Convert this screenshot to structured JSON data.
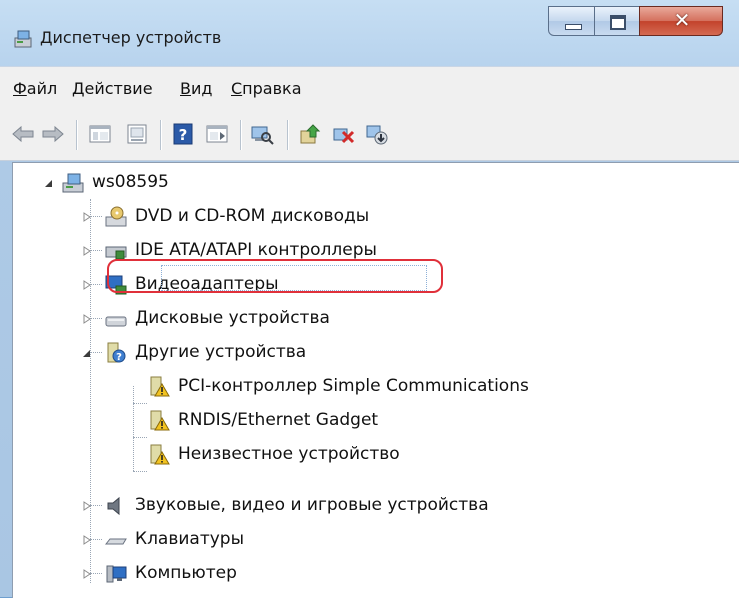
{
  "window": {
    "title": "Диспетчер устройств",
    "icon": "device-manager-icon",
    "controls": {
      "minimize": "minimize-icon",
      "maximize": "maximize-icon",
      "close": "✕"
    }
  },
  "menu": {
    "items": [
      {
        "first": "Ф",
        "rest": "айл"
      },
      {
        "first": "Д",
        "rest": "ействие"
      },
      {
        "first": "В",
        "rest": "ид"
      },
      {
        "first": "С",
        "rest": "правка"
      }
    ]
  },
  "toolbar": {
    "icons": [
      "back-arrow-icon",
      "forward-arrow-icon",
      "show-hide-tree-icon",
      "properties-icon",
      "help-icon",
      "action-pane-icon",
      "scan-hardware-icon",
      "update-driver-icon",
      "disable-device-icon",
      "uninstall-device-icon"
    ]
  },
  "tree": {
    "root": "ws08595",
    "categories": [
      {
        "label": "DVD и CD-ROM дисководы",
        "icon": "dvd-drive-icon"
      },
      {
        "label": "IDE ATA/ATAPI контроллеры",
        "icon": "ide-controller-icon"
      },
      {
        "label": "Видеоадаптеры",
        "icon": "display-adapter-icon"
      },
      {
        "label": "Дисковые устройства",
        "icon": "disk-drive-icon"
      },
      {
        "label": "Другие устройства",
        "icon": "other-devices-icon"
      },
      {
        "label": "Звуковые, видео и игровые устройства",
        "icon": "sound-icon"
      },
      {
        "label": "Клавиатуры",
        "icon": "keyboard-icon"
      },
      {
        "label": "Компьютер",
        "icon": "computer-icon"
      }
    ],
    "other_devices": [
      {
        "label": "PCI-контроллер Simple Communications",
        "icon": "warning-device-icon"
      },
      {
        "label": "RNDIS/Ethernet Gadget",
        "icon": "warning-device-icon"
      },
      {
        "label": "Неизвестное устройство",
        "icon": "warning-device-icon"
      }
    ]
  },
  "colors": {
    "highlight_outline": "#e0303a",
    "warning_yellow": "#f2c321",
    "close_red": "#c3432c"
  }
}
